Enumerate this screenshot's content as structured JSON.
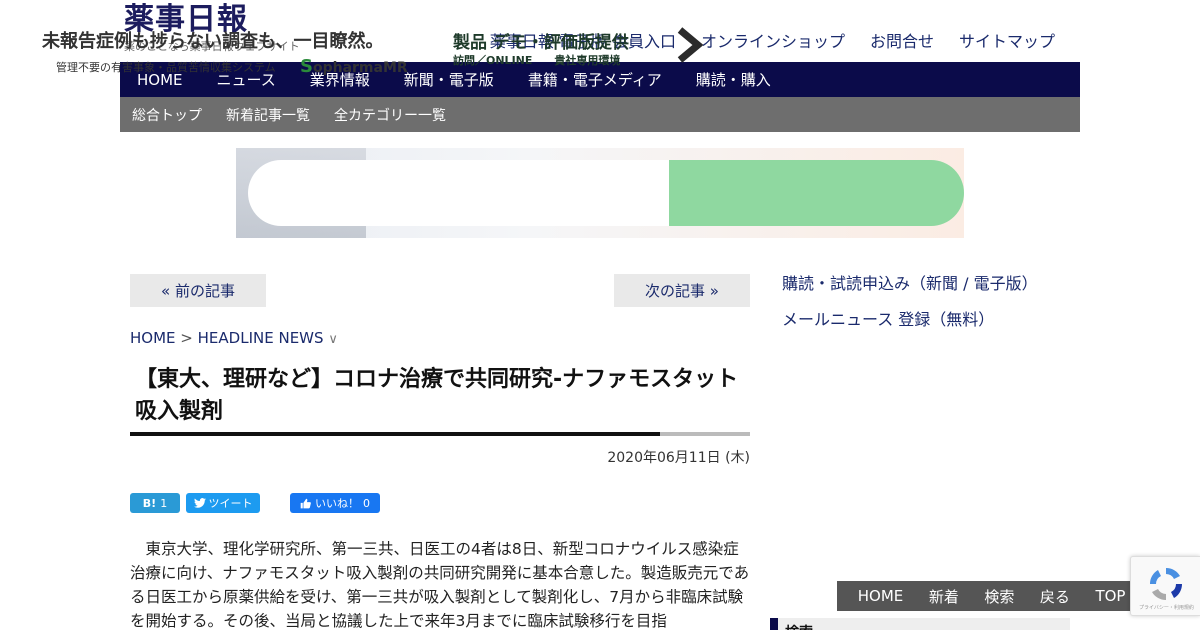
{
  "header": {
    "logo": "薬事日報",
    "tagline": "薬のことなら薬事日報ウェブサイト",
    "top_links": [
      "薬事日報 電子版 会員入口",
      "オンラインショップ",
      "お問合せ",
      "サイトマップ"
    ]
  },
  "nav_main": [
    "HOME",
    "ニュース",
    "業界情報",
    "新聞・電子版",
    "書籍・電子メディア",
    "購読・購入"
  ],
  "nav_sub": [
    "総合トップ",
    "新着記事一覧",
    "全カテゴリー一覧"
  ],
  "banner": {
    "headline": "未報告症例も捗らない調査も、一目瞭然。",
    "sub": "管理不要の有害事象・品質苦情収集システム",
    "brand": "opharmaMR",
    "brand_s": "S",
    "right_head": "製品 デモ・評価版提供",
    "right_sub": "訪問／ONLINE　　貴社専用環境",
    "colors": {
      "accent_green": "#8fd8a0"
    }
  },
  "pager": {
    "prev": "« 前の記事",
    "next": "次の記事 »"
  },
  "breadcrumb": {
    "home": "HOME",
    "sep": ">",
    "section": "HEADLINE NEWS",
    "chevron": "∨"
  },
  "article": {
    "headline": "【東大、理研など】コロナ治療で共同研究-ナファモスタット吸入製剤",
    "date": "2020年06月11日 (木)",
    "social": {
      "hatena_label": "B!",
      "hatena_count": "1",
      "tweet_label": "ツイート",
      "like_label": "いいね！",
      "like_count": "0"
    },
    "body": "東京大学、理化学研究所、第一三共、日医工の4者は8日、新型コロナウイルス感染症治療に向け、ナファモスタット吸入製剤の共同研究開発に基本合意した。製造販売元である日医工から原薬供給を受け、第一三共が吸入製剤として製剤化し、7月から非臨床試験を開始する。その後、当局と協議した上で来年3月までに臨床試験移行を目指"
  },
  "sidebar": {
    "link1": "購読・試読申込み（新聞 / 電子版）",
    "link2": "メールニュース 登録（無料）",
    "search_label": "検索"
  },
  "float_nav": [
    "HOME",
    "新着",
    "検索",
    "戻る",
    "TOP ∧"
  ],
  "recaptcha_text": "プライバシー・利用規約",
  "colors": {
    "nav_bg": "#0b0b4a",
    "sub_nav_bg": "#6e6e6e",
    "link": "#1a2a6c"
  }
}
